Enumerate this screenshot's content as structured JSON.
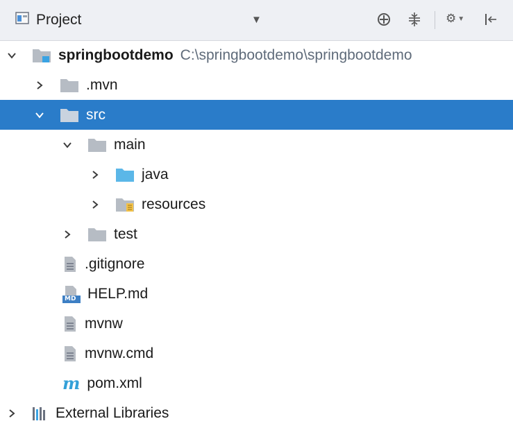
{
  "toolbar": {
    "title": "Project",
    "dropdown_icon": "triangle-down-icon",
    "actions": [
      "locate-target-icon",
      "collapse-all-icon",
      "settings-gear-icon",
      "hide-panel-icon"
    ]
  },
  "tree": {
    "root": {
      "name": "springbootdemo",
      "path": "C:\\springbootdemo\\springbootdemo"
    },
    "mvn": ".mvn",
    "src": "src",
    "main": "main",
    "java": "java",
    "resources": "resources",
    "test": "test",
    "gitignore": ".gitignore",
    "help": "HELP.md",
    "help_badge": "MD",
    "mvnw": "mvnw",
    "mvnw_cmd": "mvnw.cmd",
    "pom": "pom.xml",
    "pom_glyph": "m",
    "external": "External Libraries"
  },
  "colors": {
    "selection": "#2a7cc9",
    "folder": "#b6bcc4",
    "source_folder": "#5bb7e8",
    "module_accent": "#3aa3e3"
  }
}
